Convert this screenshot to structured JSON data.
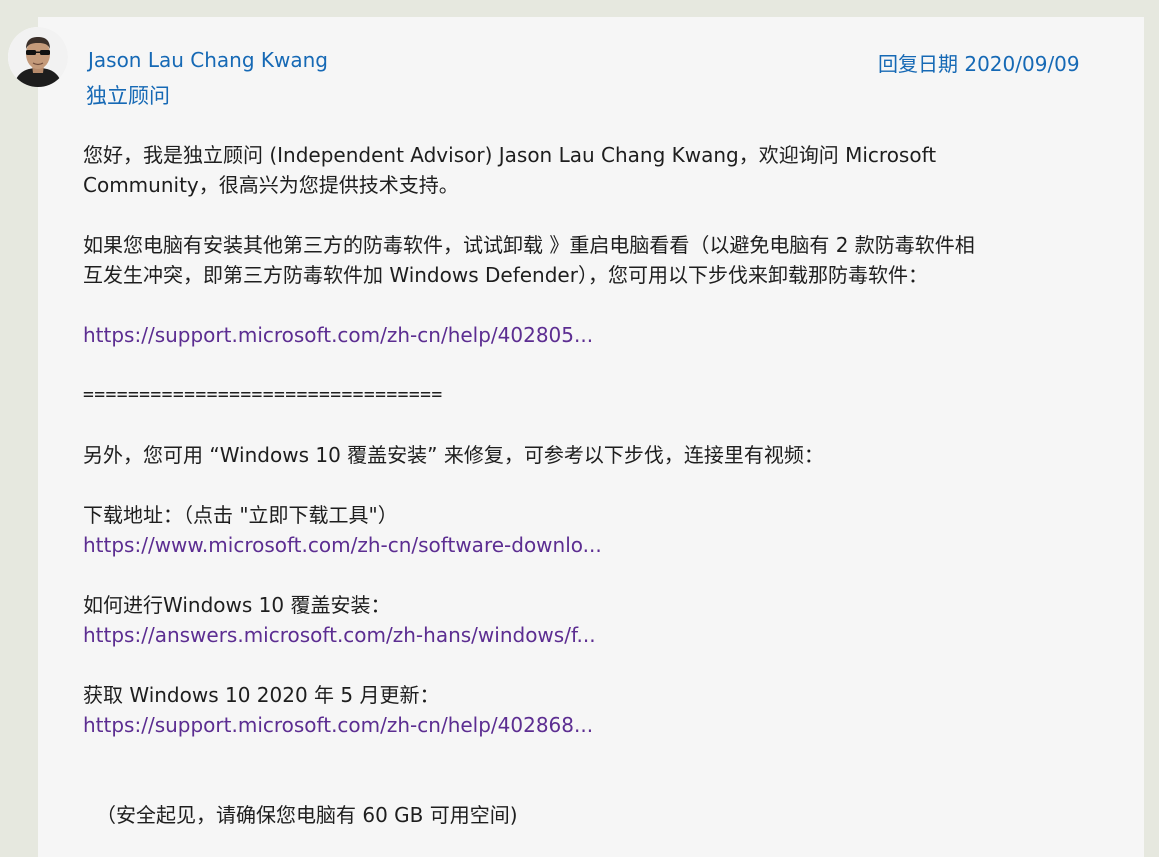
{
  "author": {
    "name": "Jason Lau Chang Kwang",
    "role": "独立顾问",
    "avatar_icon": "user-avatar-photo"
  },
  "reply_date": "回复日期 2020/09/09",
  "body": {
    "intro_1": "您好，我是独立顾问 (Independent Advisor) Jason Lau Chang Kwang，欢迎询问 Microsoft",
    "intro_2": "Community，很高兴为您提供技术支持。",
    "antivirus_1": "如果您电脑有安装其他第三方的防毒软件，试试卸载 》重启电脑看看（以避免电脑有 2 款防毒软件相",
    "antivirus_2": "互发生冲突，即第三方防毒软件加 Windows Defender），您可用以下步伐来卸载那防毒软件：",
    "link_uninstall": "https://support.microsoft.com/zh-cn/help/402805...",
    "separator": "================================",
    "repair_text": "另外，您可用 “Windows 10 覆盖安装” 来修复，可参考以下步伐，连接里有视频：",
    "download_label": "下载地址：（点击 \"立即下载工具\"）",
    "link_download": "https://www.microsoft.com/zh-cn/software-downlo...",
    "howto_label": "如何进行Windows 10 覆盖安装：",
    "link_howto": "https://answers.microsoft.com/zh-hans/windows/f...",
    "update_label": "获取 Windows 10 2020 年 5 月更新：",
    "link_update": "https://support.microsoft.com/zh-cn/help/402868...",
    "safety_note": "（安全起见，请确保您电脑有 60 GB 可用空间)"
  },
  "colors": {
    "page_bg": "#e6e8df",
    "card_bg": "#f6f6f6",
    "accent_blue": "#1669b5",
    "link_purple": "#5c2d91",
    "text": "#1e1e1e"
  }
}
